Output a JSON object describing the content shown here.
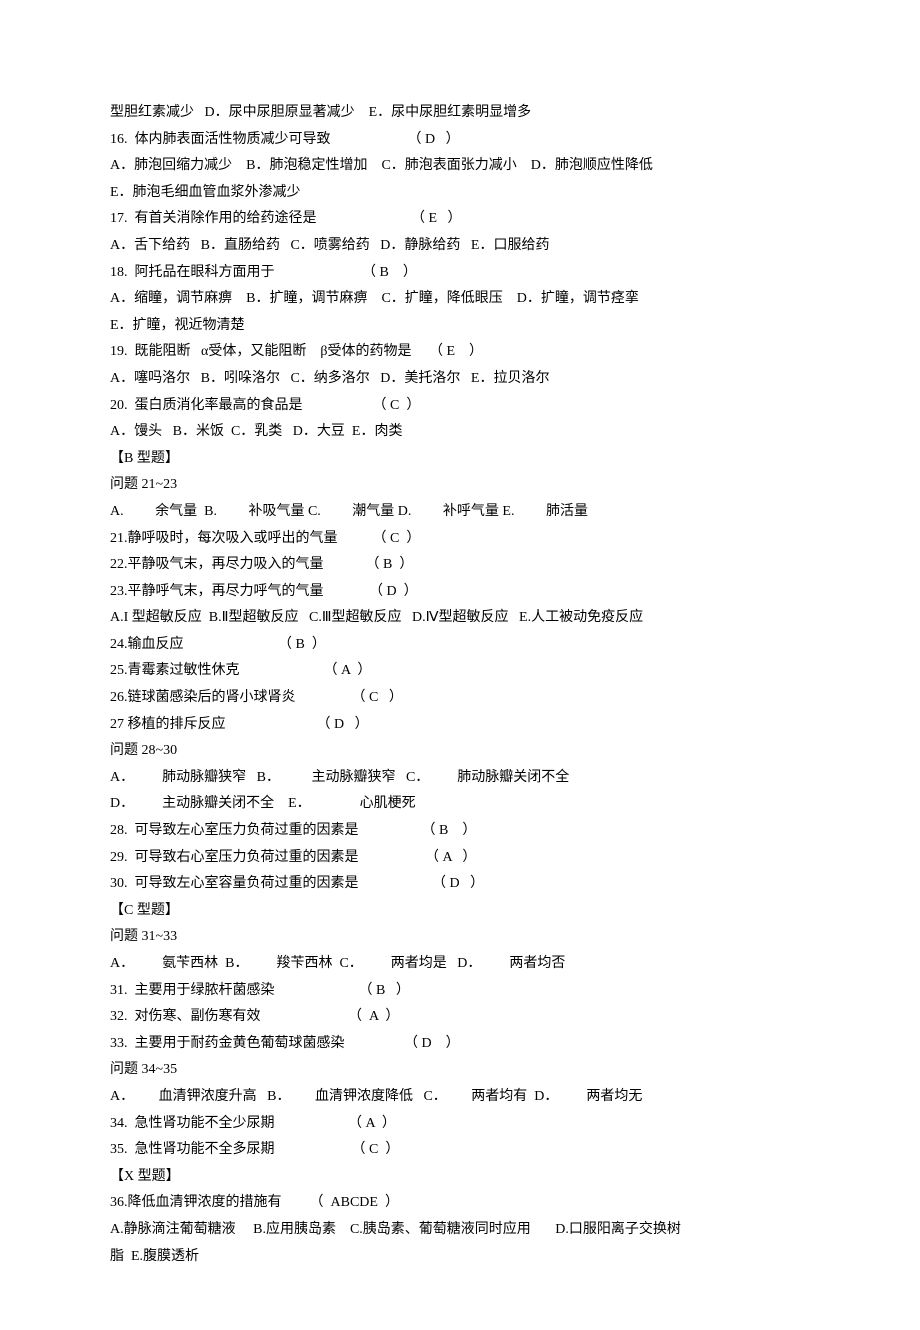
{
  "lines": [
    "型胆红素减少   D．尿中尿胆原显著减少    E．尿中尿胆红素明显增多",
    "16.  体内肺表面活性物质减少可导致                      （ D   ）",
    "A．肺泡回缩力减少    B．肺泡稳定性增加    C．肺泡表面张力减小    D．肺泡顺应性降低",
    "E．肺泡毛细血管血浆外渗减少",
    "17.  有首关消除作用的给药途径是                           （ E   ）",
    "A．舌下给药   B．直肠给药   C．喷雾给药   D．静脉给药   E．口服给药",
    "18.  阿托品在眼科方面用于                         （ B    ）",
    "A．缩瞳，调节麻痹    B．扩瞳，调节麻痹    C．扩瞳，降低眼压    D．扩瞳，调节痉挛",
    "E．扩瞳，视近物清楚",
    "19.  既能阻断   α受体，又能阻断    β受体的药物是     （ E    ）",
    "A．噻吗洛尔   B．吲哚洛尔   C．纳多洛尔   D．美托洛尔   E．拉贝洛尔",
    "20.  蛋白质消化率最高的食品是                    （ C  ）",
    "A．馒头   B．米饭  C．乳类   D．大豆  E．肉类",
    "【B 型题】",
    "问题 21~23",
    "A.         余气量  B.         补吸气量 C.         潮气量 D.         补呼气量 E.         肺活量",
    "21.静呼吸时，每次吸入或呼出的气量          （ C  ）",
    "22.平静吸气末，再尽力吸入的气量            （ B  ）",
    "23.平静呼气末，再尽力呼气的气量             （ D  ）",
    "A.I 型超敏反应  B.Ⅱ型超敏反应   C.Ⅲ型超敏反应   D.Ⅳ型超敏反应   E.人工被动免疫反应",
    "24.输血反应                           （ B  ）",
    "25.青霉素过敏性休克                        （ A  ）",
    "26.链球菌感染后的肾小球肾炎                （ C   ）",
    "27 移植的排斥反应                          （ D   ）",
    "问题 28~30",
    "A．        肺动脉瓣狭窄   B．         主动脉瓣狭窄   C．        肺动脉瓣关闭不全",
    "D．        主动脉瓣关闭不全    E．              心肌梗死",
    "28.  可导致左心室压力负荷过重的因素是                  （ B    ）",
    "29.  可导致右心室压力负荷过重的因素是                   （ A   ）",
    "30.  可导致左心室容量负荷过重的因素是                     （ D   ）",
    "【C 型题】",
    "问题 31~33",
    "A．        氨苄西林  B．        羧苄西林  C．        两者均是   D．        两者均否",
    "31.  主要用于绿脓杆菌感染                        （ B   ）",
    "32.  对伤寒、副伤寒有效                         （  A  ）",
    "33.  主要用于耐药金黄色葡萄球菌感染                 （ D    ）",
    "问题 34~35",
    "A．       血清钾浓度升高   B．       血清钾浓度降低   C．       两者均有  D．        两者均无",
    "34.  急性肾功能不全少尿期                     （ A  ）",
    "35.  急性肾功能不全多尿期                      （ C  ）",
    "【X 型题】",
    "36.降低血清钾浓度的措施有        （  ABCDE  ）",
    "A.静脉滴注葡萄糖液     B.应用胰岛素    C.胰岛素、葡萄糖液同时应用       D.口服阳离子交换树",
    "脂  E.腹膜透析"
  ]
}
